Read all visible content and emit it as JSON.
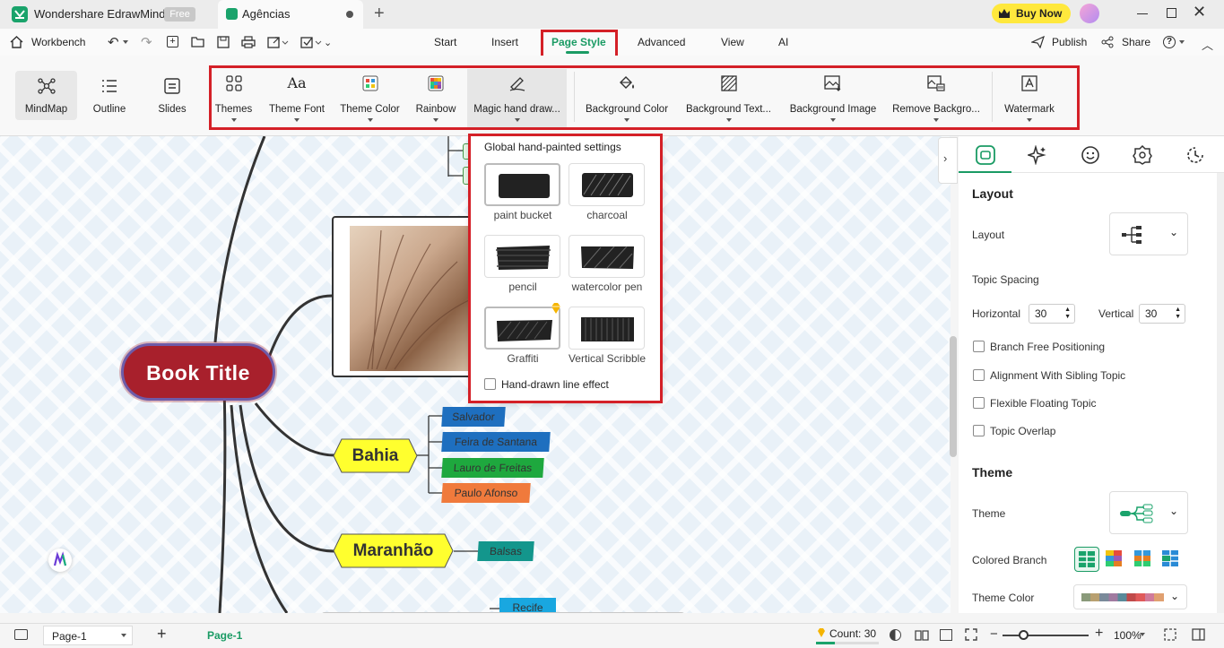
{
  "app": {
    "name": "Wondershare EdrawMind",
    "plan_badge": "Free",
    "buy_now": "Buy Now"
  },
  "document_tab": {
    "title": "Agências"
  },
  "menubar": {
    "workbench": "Workbench",
    "tabs": [
      "Start",
      "Insert",
      "Page Style",
      "Advanced",
      "View",
      "AI"
    ],
    "publish": "Publish",
    "share": "Share"
  },
  "ribbon": {
    "views": [
      "MindMap",
      "Outline",
      "Slides"
    ],
    "page_style_buttons": [
      "Themes",
      "Theme Font",
      "Theme Color",
      "Rainbow",
      "Magic hand draw...",
      "Background Color",
      "Background Text...",
      "Background Image",
      "Remove Backgro...",
      "Watermark"
    ]
  },
  "dropdown": {
    "title": "Global hand-painted settings",
    "styles": [
      "paint bucket",
      "charcoal",
      "pencil",
      "watercolor pen",
      "Graffiti",
      "Vertical Scribble"
    ],
    "checkbox_label": "Hand-drawn line effect"
  },
  "mindmap": {
    "central_topic": "Book Title",
    "main_topics": [
      "Bahia",
      "Maranhão"
    ],
    "bahia_subtopics": [
      "Salvador",
      "Feira de Santana",
      "Lauro de Freitas",
      "Paulo Afonso"
    ],
    "maranhao_subtopics": [
      "Balsas"
    ],
    "partial_topic": "Recife"
  },
  "panel": {
    "layout_title": "Layout",
    "layout_label": "Layout",
    "topic_spacing_label": "Topic Spacing",
    "horizontal_label": "Horizontal",
    "horizontal_value": "30",
    "vertical_label": "Vertical",
    "vertical_value": "30",
    "checkboxes": [
      "Branch Free Positioning",
      "Alignment With Sibling Topic",
      "Flexible Floating Topic",
      "Topic Overlap"
    ],
    "theme_title": "Theme",
    "theme_label": "Theme",
    "colored_branch_label": "Colored Branch",
    "theme_color_label": "Theme Color"
  },
  "statusbar": {
    "page_select": "Page-1",
    "page_tab": "Page-1",
    "count": "Count: 30",
    "zoom": "100%"
  },
  "colors": {
    "accent": "#1a9b64",
    "highlight_box": "#d42027",
    "central_topic": "#a8202c",
    "main_topic": "#ffff2e",
    "buy_now": "#ffe83d"
  }
}
